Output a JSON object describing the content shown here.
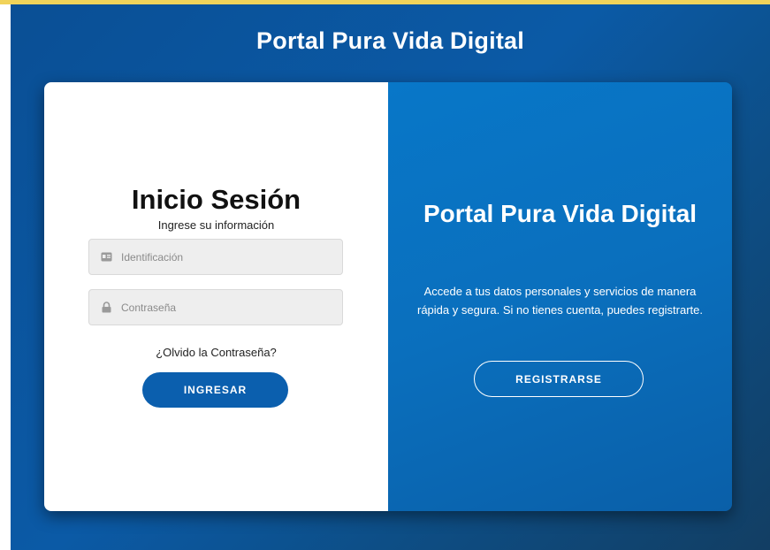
{
  "header": {
    "title": "Portal Pura Vida Digital"
  },
  "login": {
    "title": "Inicio Sesión",
    "subtitle": "Ingrese su información",
    "id_field": {
      "placeholder": "Identificación",
      "value": "",
      "icon": "id-card-icon"
    },
    "password_field": {
      "placeholder": "Contraseña",
      "value": "",
      "icon": "lock-icon"
    },
    "forgot_link": "¿Olvido la Contraseña?",
    "submit_label": "INGRESAR"
  },
  "info": {
    "title": "Portal Pura Vida Digital",
    "text": "Accede a tus datos personales y servicios de manera rápida y segura. Si no tienes cuenta, puedes registrarte.",
    "register_label": "REGISTRARSE"
  },
  "colors": {
    "accent": "#0b5fae",
    "panel_blue": "#0877c8",
    "background_blue": "#0a4f95",
    "top_strip": "#f1d35a"
  }
}
